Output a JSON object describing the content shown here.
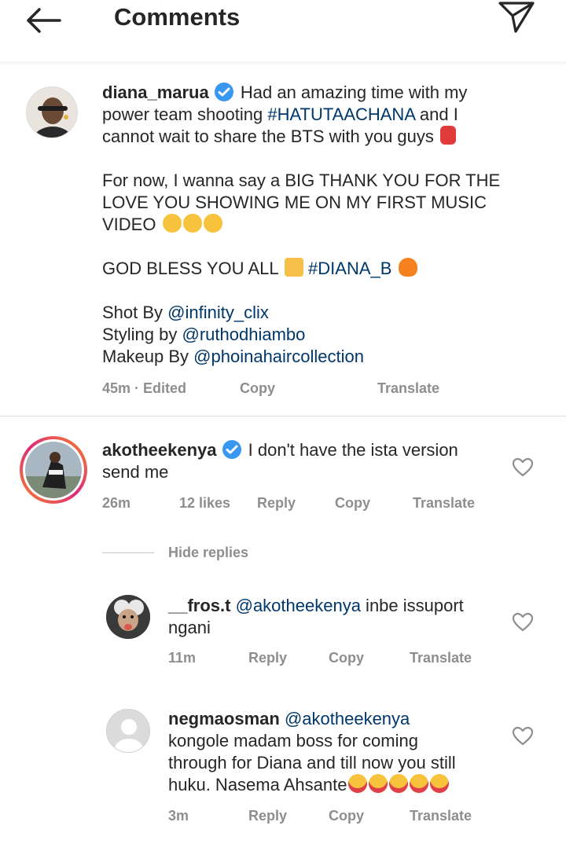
{
  "header": {
    "title": "Comments",
    "back_icon": "arrow-left-icon",
    "share_icon": "paper-plane-icon"
  },
  "caption": {
    "username": "diana_marua",
    "line1_text": "Had an amazing time with my",
    "line2_text_a": "power team shooting ",
    "hashtag1": "#HATUTAACHANA",
    "line2_text_b": " and I",
    "line3_text": "cannot wait to share the BTS with you guys",
    "para2_line1": "For now, I wanna say a BIG THANK YOU FOR THE",
    "para2_line2": "LOVE YOU SHOWING ME ON MY FIRST MUSIC",
    "para2_line3": "VIDEO",
    "para3_text": "GOD BLESS YOU ALL",
    "hashtag2": "#DIANA_B",
    "shot_by_label": "Shot By ",
    "shot_by_handle": "@infinity_clix",
    "styling_label": "Styling by ",
    "styling_handle": "@ruthodhiambo",
    "makeup_label": "Makeup By ",
    "makeup_handle": "@phoinahaircollection",
    "time": "45m · Edited",
    "copy": "Copy",
    "translate": "Translate"
  },
  "comments": [
    {
      "username": "akotheekenya",
      "text": "I don't have the ista version",
      "text_line2": "send me",
      "time": "26m",
      "likes": "12 likes",
      "reply": "Reply",
      "copy": "Copy",
      "translate": "Translate"
    }
  ],
  "hide_replies": "Hide replies",
  "replies": [
    {
      "username": "__fros.t",
      "mention": "@akotheekenya",
      "text": " inbe issuport",
      "text_line2": "ngani",
      "time": "11m",
      "reply": "Reply",
      "copy": "Copy",
      "translate": "Translate"
    },
    {
      "username": "negmaosman",
      "mention": "@akotheekenya",
      "text_line2": "kongole madam boss for coming",
      "text_line3": "through for Diana and till now you still",
      "text_line4": "huku. Nasema Ahsante",
      "time": "3m",
      "reply": "Reply",
      "copy": "Copy",
      "translate": "Translate"
    }
  ],
  "colors": {
    "link": "#00376b",
    "verified": "#3897f0",
    "muted": "#8e8e8e",
    "story_ring_start": "#f58529",
    "story_ring_end": "#dd2a7b"
  }
}
